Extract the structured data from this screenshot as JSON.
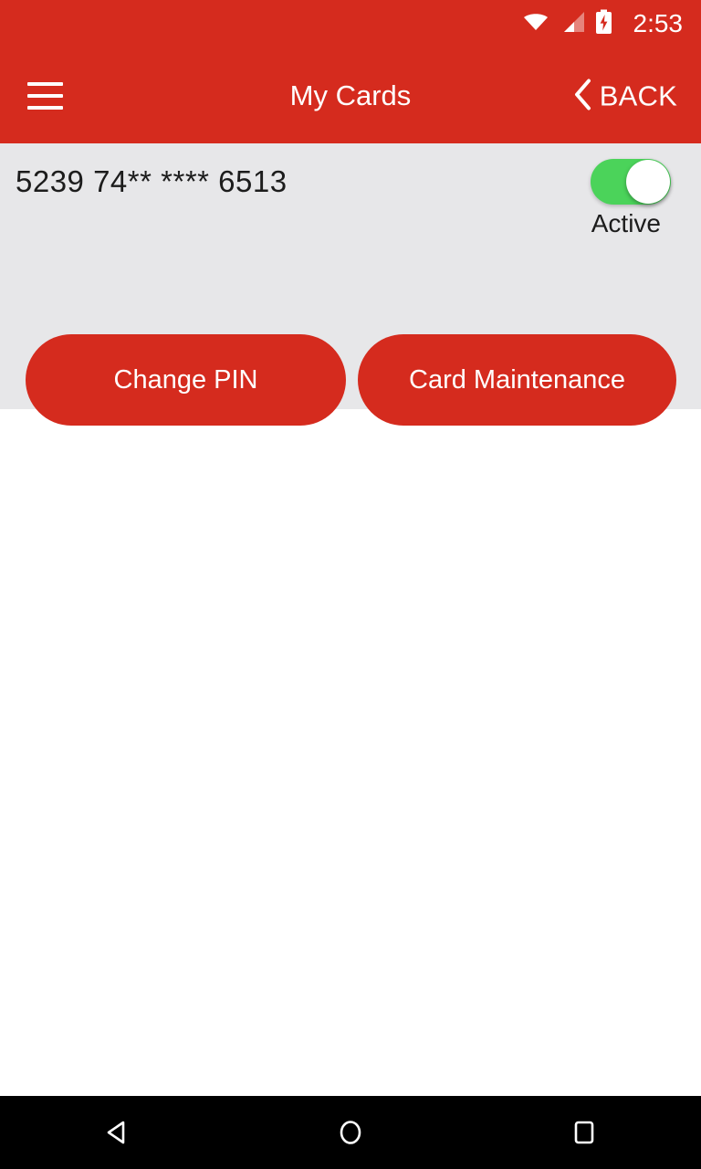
{
  "status_bar": {
    "time": "2:53",
    "icons": [
      {
        "name": "wifi-icon",
        "label": "wifi-full"
      },
      {
        "name": "cellular-signal-icon",
        "label": "signal-partial"
      },
      {
        "name": "battery-charging-icon",
        "label": "battery-charging"
      }
    ]
  },
  "app_bar": {
    "menu_icon": "hamburger-menu-icon",
    "title": "My Cards",
    "back_label": "BACK",
    "back_icon": "chevron-left-icon"
  },
  "card": {
    "masked_number": "5239 74** **** 6513",
    "toggle": {
      "state": "on",
      "status_label": "Active"
    },
    "actions": [
      {
        "label": "Change PIN",
        "name": "change-pin-button"
      },
      {
        "label": "Card Maintenance",
        "name": "card-maintenance-button"
      }
    ]
  },
  "nav_bar": {
    "buttons": [
      {
        "name": "android-back-button",
        "label": "back"
      },
      {
        "name": "android-home-button",
        "label": "home"
      },
      {
        "name": "android-recents-button",
        "label": "recents"
      }
    ]
  },
  "colors": {
    "brand_red": "#D52B1E",
    "panel_gray": "#E7E7E9",
    "toggle_green": "#4BD35A",
    "nav_black": "#000000",
    "text_dark": "#1c1c1c",
    "text_light": "#ffffff"
  }
}
